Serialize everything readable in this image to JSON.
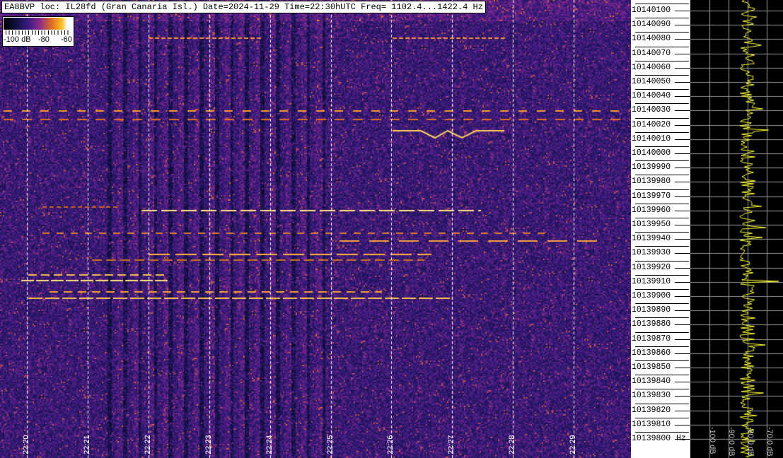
{
  "header": {
    "title": "EA8BVP loc: IL28fd (Gran Canaria Isl.) Date=2024-11-29 Time=22:30hUTC Freq= 1102.4...1422.4 Hz"
  },
  "colorbar": {
    "labels": [
      "-100 dB",
      "-80",
      "-60"
    ]
  },
  "time_axis": {
    "labels": [
      "22:20",
      "22:21",
      "22:22",
      "22:23",
      "22:24",
      "22:25",
      "22:26",
      "22:27",
      "22:28",
      "22:29"
    ]
  },
  "freq_axis": {
    "labels": [
      "10140100",
      "10140090",
      "10140080",
      "10140070",
      "10140060",
      "10140050",
      "10140040",
      "10140030",
      "10140020",
      "10140010",
      "10140000",
      "10139990",
      "10139980",
      "10139970",
      "10139960",
      "10139950",
      "10139940",
      "10139930",
      "10139920",
      "10139910",
      "10139900",
      "10139890",
      "10139880",
      "10139870",
      "10139860",
      "10139850",
      "10139840",
      "10139830",
      "10139820",
      "10139810",
      "10139800"
    ],
    "unit": "Hz"
  },
  "level_panel": {
    "labels": [
      "-100 dB",
      "-90.0 dB",
      "-80.0 dB",
      "-70.0 dB"
    ]
  },
  "colors": {
    "background": "#3a1a80",
    "trace": "#ffff30",
    "grid": "#9a9a9a"
  }
}
